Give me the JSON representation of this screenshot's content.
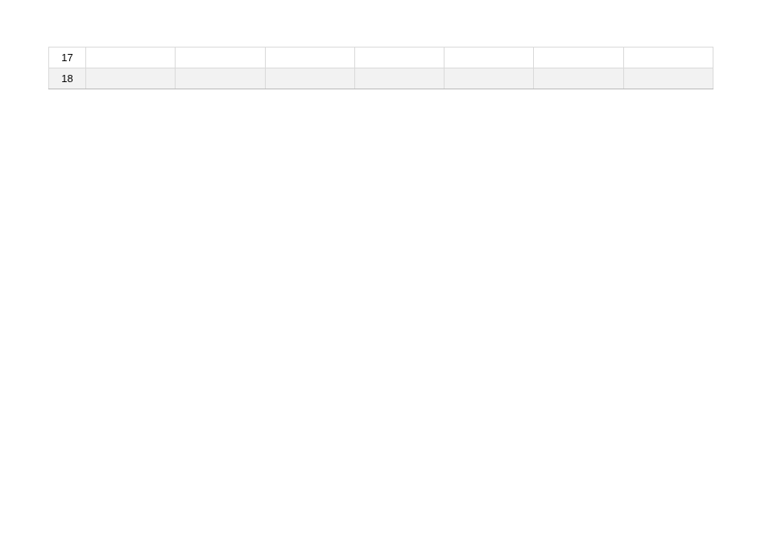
{
  "table": {
    "rows": [
      {
        "num": "17",
        "banded": false,
        "cells": [
          "",
          "",
          "",
          "",
          "",
          "",
          ""
        ]
      },
      {
        "num": "18",
        "banded": true,
        "cells": [
          "",
          "",
          "",
          "",
          "",
          "",
          ""
        ]
      }
    ],
    "data_column_count": 7
  }
}
